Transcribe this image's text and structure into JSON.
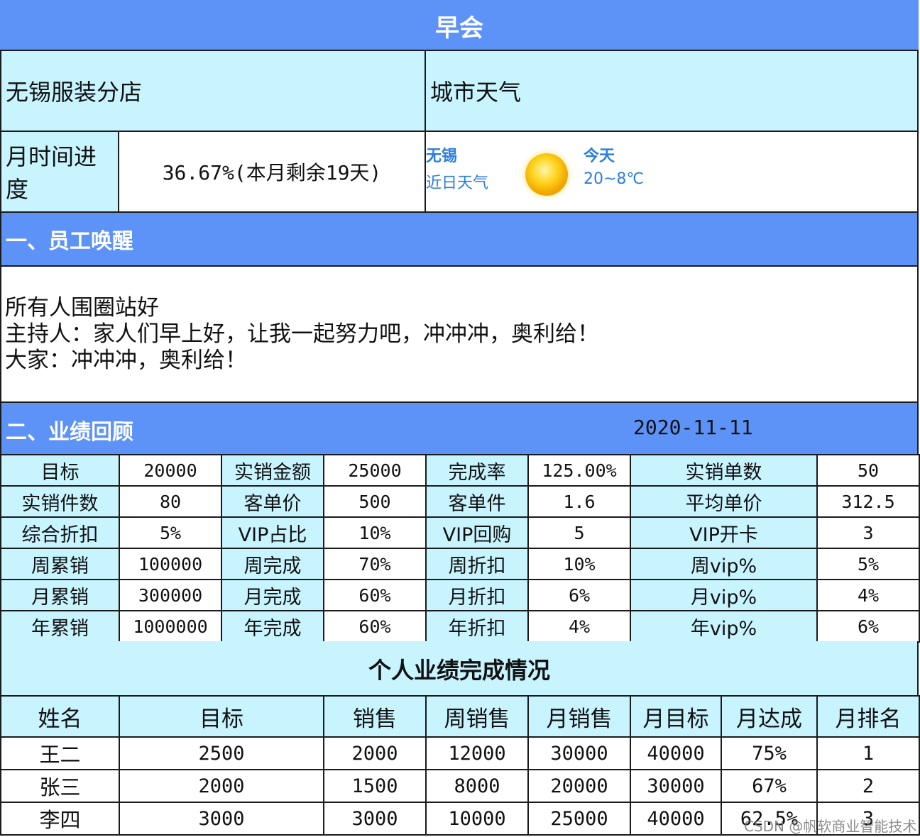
{
  "title": "早会",
  "store": {
    "name": "无锡服装分店",
    "weather_label": "城市天气"
  },
  "progress": {
    "label": "月时间进度",
    "value": "36.67%(本月剩余19天)"
  },
  "weather": {
    "city": "无锡",
    "recent": "近日天气",
    "today": "今天",
    "temp": "20~8℃",
    "icon": "sun-icon",
    "accent": "#2a7de1"
  },
  "section1": {
    "title": "一、员工唤醒",
    "lines": [
      "所有人围圈站好",
      "主持人：家人们早上好，让我一起努力吧，冲冲冲，奥利给！",
      "大家：冲冲冲，奥利给！"
    ]
  },
  "section2": {
    "title": "二、业绩回顾",
    "date": "2020-11-11"
  },
  "kpi_rows": [
    [
      "目标",
      "20000",
      "实销金额",
      "25000",
      "完成率",
      "125.00%",
      "实销单数",
      "50"
    ],
    [
      "实销件数",
      "80",
      "客单价",
      "500",
      "客单件",
      "1.6",
      "平均单价",
      "312.5"
    ],
    [
      "综合折扣",
      "5%",
      "VIP占比",
      "10%",
      "VIP回购",
      "5",
      "VIP开卡",
      "3"
    ],
    [
      "周累销",
      "100000",
      "周完成",
      "70%",
      "周折扣",
      "10%",
      "周vip%",
      "5%"
    ],
    [
      "月累销",
      "300000",
      "月完成",
      "60%",
      "月折扣",
      "6%",
      "月vip%",
      "4%"
    ],
    [
      "年累销",
      "1000000",
      "年完成",
      "60%",
      "年折扣",
      "4%",
      "年vip%",
      "6%"
    ]
  ],
  "personal": {
    "title": "个人业绩完成情况",
    "headers": [
      "姓名",
      "目标",
      "销售",
      "周销售",
      "月销售",
      "月目标",
      "月达成",
      "月排名"
    ],
    "rows": [
      [
        "王二",
        "2500",
        "2000",
        "12000",
        "30000",
        "40000",
        "75%",
        "1"
      ],
      [
        "张三",
        "2000",
        "1500",
        "8000",
        "20000",
        "30000",
        "67%",
        "2"
      ],
      [
        "李四",
        "3000",
        "3000",
        "10000",
        "25000",
        "40000",
        "62.5%",
        "3"
      ]
    ]
  },
  "watermark": "CSDN @帆软商业智能技术",
  "colors": {
    "header_bar": "#5d93f6",
    "cell_bg": "#c8f4ff",
    "border": "#1b1b1b"
  }
}
